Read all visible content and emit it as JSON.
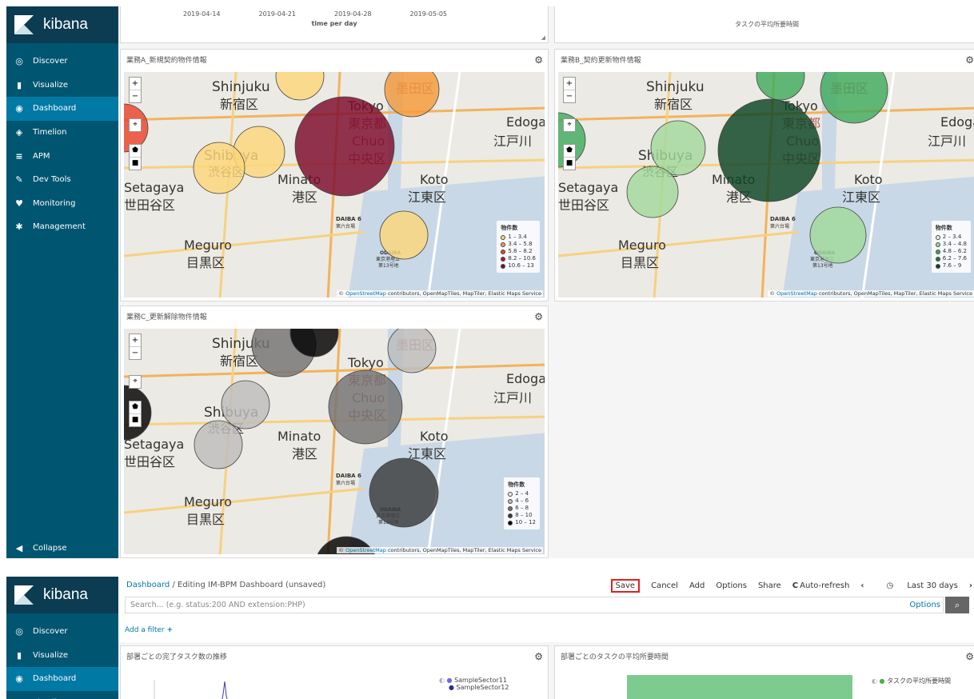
{
  "app": {
    "name": "kibana"
  },
  "nav": [
    {
      "label": "Discover",
      "icon": "compass-icon"
    },
    {
      "label": "Visualize",
      "icon": "bar-chart-icon"
    },
    {
      "label": "Dashboard",
      "icon": "dashboard-icon"
    },
    {
      "label": "Timelion",
      "icon": "timelion-icon"
    },
    {
      "label": "APM",
      "icon": "apm-icon"
    },
    {
      "label": "Dev Tools",
      "icon": "wrench-icon"
    },
    {
      "label": "Monitoring",
      "icon": "heartbeat-icon"
    },
    {
      "label": "Management",
      "icon": "gear-icon"
    }
  ],
  "collapse_label": "Collapse",
  "top_panels": {
    "left": {
      "ticks": [
        "2019-04-14",
        "2019-04-21",
        "2019-04-28",
        "2019-05-05"
      ],
      "xlabel": "time per day"
    },
    "right": {
      "xlabel": "タスクの平均所要時間"
    }
  },
  "map_labels": {
    "shinjuku_en": "Shinjuku",
    "shinjuku_jp": "新宿区",
    "shibuya_en": "Shibuya",
    "shibuya_jp": "渋谷区",
    "setagaya_en": "Setagaya",
    "setagaya_jp": "世田谷区",
    "tokyo_en": "Tokyo",
    "tokyo_jp": "東京都",
    "chuo_en": "Chuo",
    "chuo_jp": "中央区",
    "minato_en": "Minato",
    "minato_jp": "港区",
    "koto_en": "Koto",
    "koto_jp": "江東区",
    "meguro_en": "Meguro",
    "meguro_jp": "目黒区",
    "edogawa_en": "Edoga",
    "edogawa_jp": "江戸川",
    "sumida_jp": "墨田区",
    "daiba": "DAIBA 6",
    "daiba_jp": "第六台場",
    "odaiba": "ODAIBA",
    "odaiba_jp": "東京港埋立",
    "odaiba_no": "第13号地"
  },
  "attribution": {
    "prefix": "©",
    "link": "OpenStreetMap",
    "rest": "contributors, OpenMapTiles, MapTiler, Elastic Maps Service"
  },
  "maps": [
    {
      "title": "業務A_新規契約物件情報",
      "legend_title": "物件数",
      "legend": [
        {
          "label": "1 – 3.4",
          "color": "#fdd77a"
        },
        {
          "label": "3.4 – 5.8",
          "color": "#f59b3b"
        },
        {
          "label": "5.8 – 8.2",
          "color": "#e9442c"
        },
        {
          "label": "8.2 – 10.6",
          "color": "#b8132c"
        },
        {
          "label": "10.6 – 13",
          "color": "#7d0a2c"
        }
      ]
    },
    {
      "title": "業務B_契約更新物件情報",
      "legend_title": "物件数",
      "legend": [
        {
          "label": "2 – 3.4",
          "color": "#e5f5e0"
        },
        {
          "label": "3.4 – 4.8",
          "color": "#a1d99b"
        },
        {
          "label": "4.8 – 6.2",
          "color": "#41ab5d"
        },
        {
          "label": "6.2 – 7.6",
          "color": "#1e7a3c"
        },
        {
          "label": "7.6 – 9",
          "color": "#0b4425"
        }
      ]
    },
    {
      "title": "業務C_更新解除物件情報",
      "legend_title": "物件数",
      "legend": [
        {
          "label": "2 – 4",
          "color": "#f0f0f0"
        },
        {
          "label": "4 – 6",
          "color": "#bdbdbd"
        },
        {
          "label": "6 – 8",
          "color": "#737373"
        },
        {
          "label": "8 – 10",
          "color": "#3a3a3a"
        },
        {
          "label": "10 – 12",
          "color": "#000000"
        }
      ]
    }
  ],
  "editor": {
    "breadcrumb_link": "Dashboard",
    "breadcrumb_sep": "/",
    "breadcrumb_current": "Editing IM-BPM Dashboard (unsaved)",
    "menu": {
      "save": "Save",
      "cancel": "Cancel",
      "add": "Add",
      "options": "Options",
      "share": "Share",
      "autorefresh": "Auto-refresh",
      "timerange": "Last 30 days"
    },
    "search_placeholder": "Search... (e.g. status:200 AND extension:PHP)",
    "search_options": "Options",
    "add_filter": "Add a filter",
    "panel1_title": "部署ごとの完了タスク数の推移",
    "panel2_title": "部署ごとのタスクの平均所要時間",
    "legend1_item1": "SampleSector11",
    "legend1_item2": "SampleSector12",
    "legend2_item1": "タスクの平均所要時間"
  },
  "colors": {
    "sidebar": "#005571",
    "sidebar_active": "#0079a5",
    "logo_bg": "#0b3c51",
    "link": "#0079a5",
    "save_highlight": "#e32020",
    "bar_green": "#7ecb8f",
    "series_purple": "#6c6cd6",
    "series_navy": "#2a2a9a",
    "series_green": "#4caf50"
  }
}
